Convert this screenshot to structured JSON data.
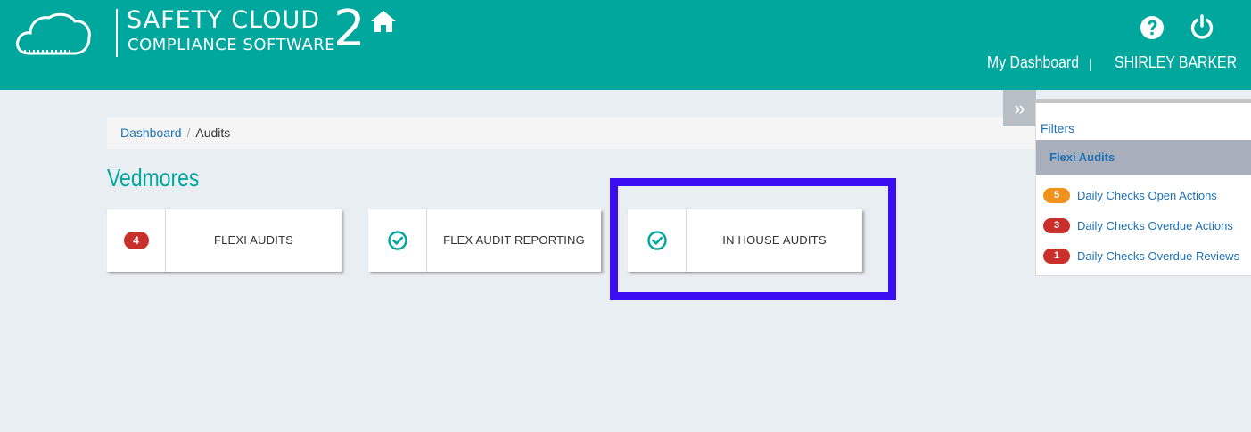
{
  "header": {
    "logo_title": "SAFETY CLOUD",
    "logo_subtitle": "COMPLIANCE SOFTWARE",
    "logo_number": "2",
    "nav_dashboard": "My Dashboard",
    "nav_separator": "|",
    "user_name": "SHIRLEY BARKER"
  },
  "breadcrumb": {
    "items": [
      {
        "label": "Dashboard"
      },
      {
        "label": "Audits"
      }
    ],
    "separator": "/"
  },
  "page": {
    "title": "Vedmores"
  },
  "tiles": [
    {
      "label": "FLEXI AUDITS",
      "badge": "4",
      "icon": "badge"
    },
    {
      "label": "FLEX AUDIT REPORTING",
      "icon": "check-circle-icon"
    },
    {
      "label": "IN HOUSE AUDITS",
      "icon": "check-circle-icon"
    }
  ],
  "filters": {
    "toggle": "»",
    "link": "Filters",
    "group_title": "Flexi Audits",
    "items": [
      {
        "count": "5",
        "label": "Daily Checks Open Actions",
        "color": "#f0931c"
      },
      {
        "count": "3",
        "label": "Daily Checks Overdue Actions",
        "color": "#c9302c"
      },
      {
        "count": "1",
        "label": "Daily Checks Overdue Reviews",
        "color": "#c9302c"
      }
    ]
  },
  "colors": {
    "brand": "#00a79d",
    "link": "#1f6fb2",
    "highlight": "#3a0df2"
  }
}
